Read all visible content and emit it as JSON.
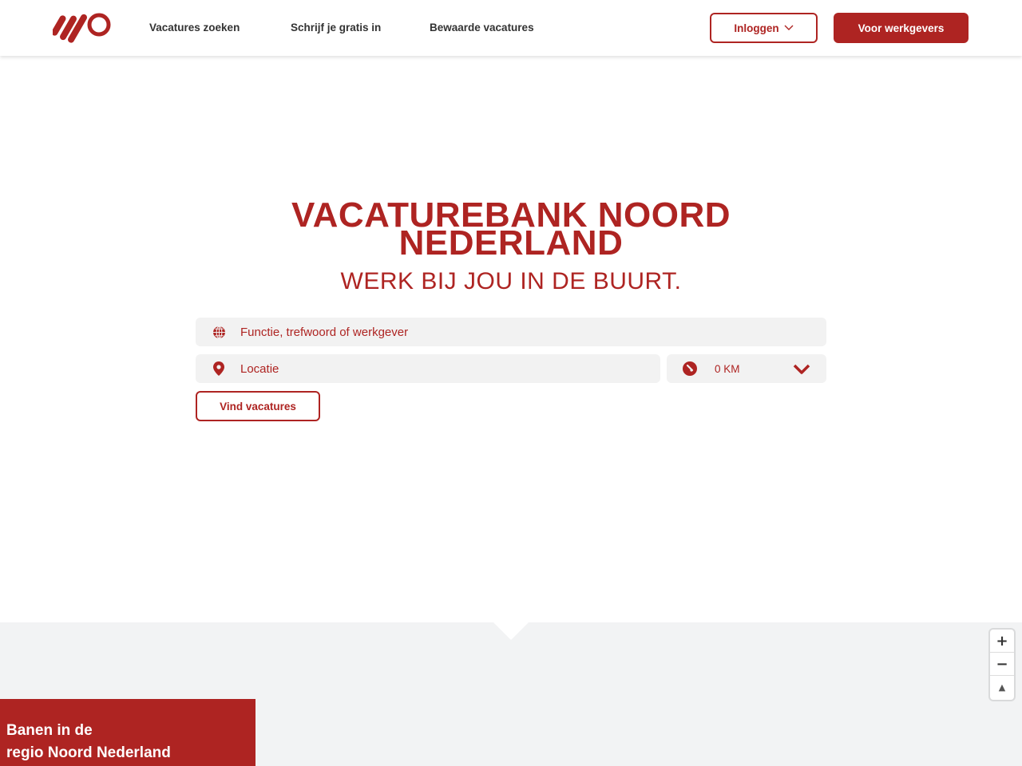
{
  "header": {
    "nav": [
      "Vacatures zoeken",
      "Schrijf je gratis in",
      "Bewaarde vacatures"
    ],
    "login_label": "Inloggen",
    "employers_label": "Voor werkgevers"
  },
  "hero": {
    "title_line1": "VACATUREBANK NOORD",
    "title_line2": "NEDERLAND",
    "subtitle": "WERK BIJ JOU IN DE BUURT."
  },
  "search": {
    "keyword_placeholder": "Functie, trefwoord of werkgever",
    "location_placeholder": "Locatie",
    "radius_value": "0 KM",
    "submit_label": "Vind vacatures"
  },
  "map": {
    "region_line1": "Banen in de",
    "region_line2": "regio Noord Nederland",
    "zoom_in": "+",
    "zoom_out": "−",
    "reset": "▲"
  },
  "colors": {
    "brand": "#ae2422",
    "field": "#f2f2f2",
    "map_bg": "#f2f3f4"
  }
}
